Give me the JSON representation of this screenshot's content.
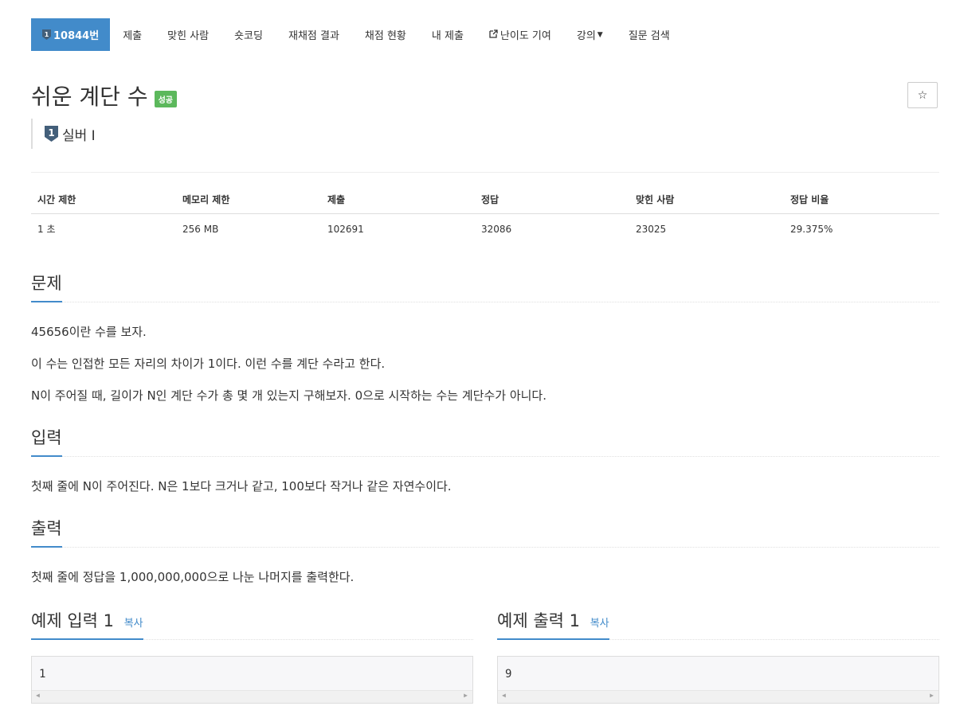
{
  "nav": {
    "problem_id": "10844번",
    "items": [
      "제출",
      "맞힌 사람",
      "숏코딩",
      "재채점 결과",
      "채점 현황",
      "내 제출"
    ],
    "difficulty": "난이도 기여",
    "lecture": "강의",
    "qna": "질문 검색"
  },
  "problem": {
    "title": "쉬운 계단 수",
    "status": "성공",
    "tier_num": "1",
    "tier": "실버 I",
    "star": "☆"
  },
  "info": {
    "headers": [
      "시간 제한",
      "메모리 제한",
      "제출",
      "정답",
      "맞힌 사람",
      "정답 비율"
    ],
    "values": [
      "1 초",
      "256 MB",
      "102691",
      "32086",
      "23025",
      "29.375%"
    ]
  },
  "description": {
    "title": "문제",
    "lines": [
      "45656이란 수를 보자.",
      "이 수는 인접한 모든 자리의 차이가 1이다. 이런 수를 계단 수라고 한다.",
      "N이 주어질 때, 길이가 N인 계단 수가 총 몇 개 있는지 구해보자. 0으로 시작하는 수는 계단수가 아니다."
    ]
  },
  "input": {
    "title": "입력",
    "text": "첫째 줄에 N이 주어진다. N은 1보다 크거나 같고, 100보다 작거나 같은 자연수이다."
  },
  "output": {
    "title": "출력",
    "text": "첫째 줄에 정답을 1,000,000,000으로 나눈 나머지를 출력한다."
  },
  "samples": {
    "input_title": "예제 입력 1",
    "output_title": "예제 출력 1",
    "copy": "복사",
    "input_value": "1",
    "output_value": "9"
  },
  "colors": {
    "primary": "#428bca",
    "success": "#5cb85c",
    "tier_badge": "#435f7a"
  }
}
